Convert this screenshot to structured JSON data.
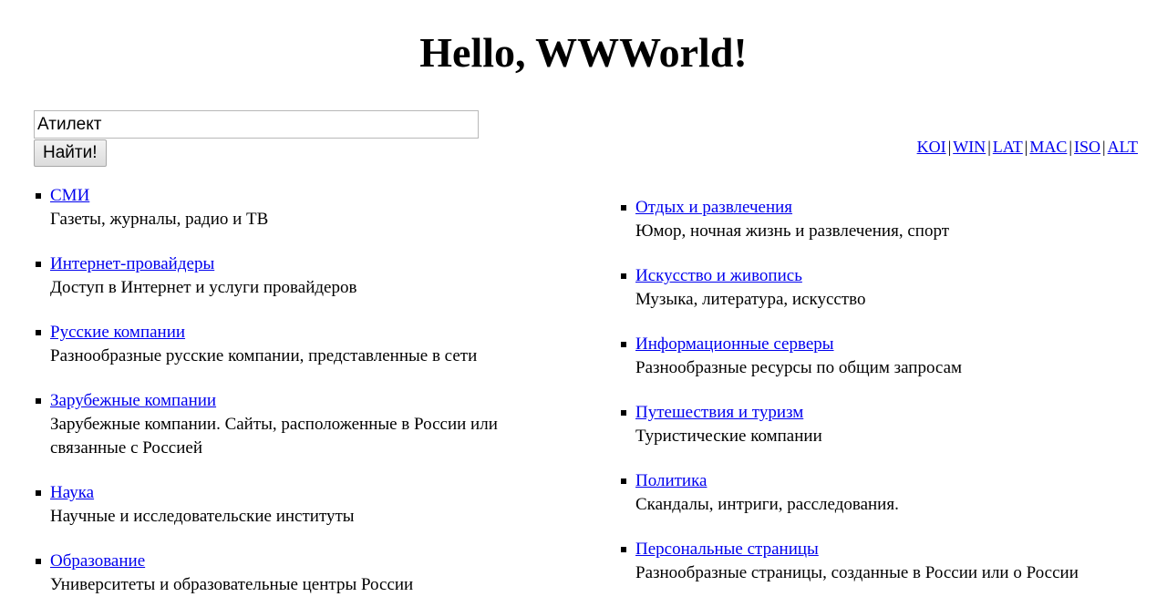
{
  "page": {
    "title": "Hello, WWWorld!"
  },
  "search": {
    "value": "Атилект",
    "button_label": "Найти!"
  },
  "encodings": [
    "KOI",
    "WIN",
    "LAT",
    "MAC",
    "ISO",
    "ALT"
  ],
  "encoding_separator": "|",
  "categories_left": [
    {
      "title": "СМИ",
      "description": "Газеты, журналы, радио и ТВ"
    },
    {
      "title": "Интернет-провайдеры",
      "description": "Доступ в Интернет и услуги провайдеров"
    },
    {
      "title": "Русские компании",
      "description": "Разнообразные русские компании, представленные в сети"
    },
    {
      "title": "Зарубежные компании",
      "description": "Зарубежные компании. Сайты, расположенные в России или связанные с Россией"
    },
    {
      "title": "Наука",
      "description": "Научные и исследовательские институты"
    },
    {
      "title": "Образование",
      "description": "Университеты и образовательные центры России"
    }
  ],
  "categories_right": [
    {
      "title": "Отдых и развлечения",
      "description": "Юмор, ночная жизнь и развлечения, спорт"
    },
    {
      "title": "Искусство и живопись",
      "description": "Музыка, литература, искусство"
    },
    {
      "title": "Информационные серверы",
      "description": "Разнообразные ресурсы по общим запросам"
    },
    {
      "title": "Путешествия и туризм",
      "description": "Туристические компании"
    },
    {
      "title": "Политика",
      "description": "Скандалы, интриги, расследования."
    },
    {
      "title": "Персональные страницы",
      "description": "Разнообразные страницы, созданные в России или о России"
    }
  ],
  "colors": {
    "link": "#0000ee",
    "text": "#000000",
    "background": "#ffffff"
  }
}
